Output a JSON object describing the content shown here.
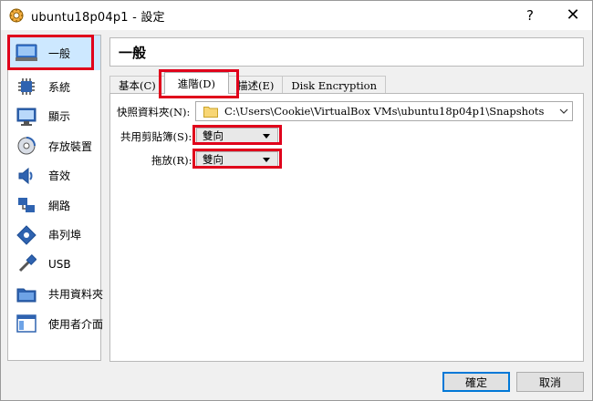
{
  "window": {
    "title": "ubuntu18p04p1 - 設定",
    "help_label": "?",
    "close_label": "✕"
  },
  "sidebar": {
    "items": [
      {
        "label": "一般",
        "icon": "general-monitor-icon"
      },
      {
        "label": "系統",
        "icon": "system-chip-icon"
      },
      {
        "label": "顯示",
        "icon": "display-monitor-icon"
      },
      {
        "label": "存放裝置",
        "icon": "storage-disc-icon"
      },
      {
        "label": "音效",
        "icon": "audio-speaker-icon"
      },
      {
        "label": "網路",
        "icon": "network-icon"
      },
      {
        "label": "串列埠",
        "icon": "serial-port-icon"
      },
      {
        "label": "USB",
        "icon": "usb-icon"
      },
      {
        "label": "共用資料夾",
        "icon": "shared-folder-icon"
      },
      {
        "label": "使用者介面",
        "icon": "user-interface-icon"
      }
    ]
  },
  "page": {
    "title": "一般"
  },
  "tabs": [
    {
      "label": "基本(C)"
    },
    {
      "label": "進階(D)"
    },
    {
      "label": "描述(E)"
    },
    {
      "label": "Disk Encryption"
    }
  ],
  "advanced": {
    "snapshot_label": "快照資料夾(N):",
    "snapshot_path": "C:\\Users\\Cookie\\VirtualBox VMs\\ubuntu18p04p1\\Snapshots",
    "clipboard_label": "共用剪貼簿(S):",
    "clipboard_value": "雙向",
    "dragdrop_label": "拖放(R):",
    "dragdrop_value": "雙向"
  },
  "buttons": {
    "ok": "確定",
    "cancel": "取消"
  },
  "colors": {
    "highlight": "#e0001b",
    "selected_bg": "#cde8ff",
    "accent": "#0078d7"
  }
}
